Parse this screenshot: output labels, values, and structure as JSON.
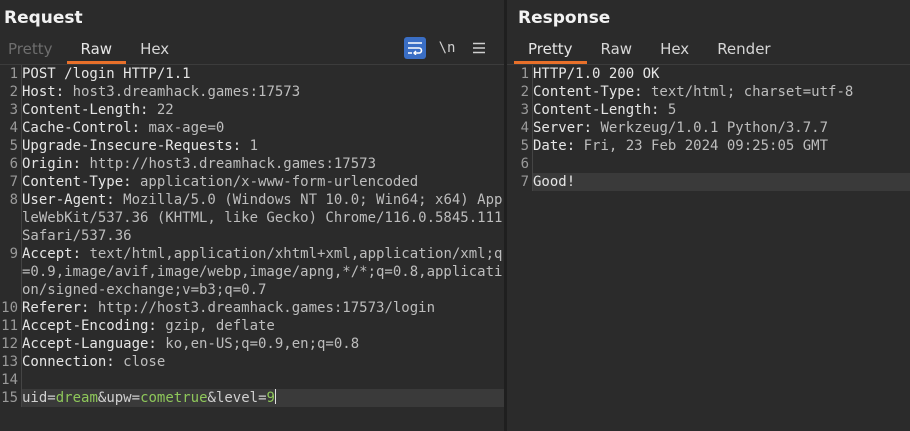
{
  "request": {
    "title": "Request",
    "tabs": [
      {
        "label": "Pretty",
        "state": "disabled"
      },
      {
        "label": "Raw",
        "state": "active"
      },
      {
        "label": "Hex",
        "state": "normal"
      }
    ],
    "toolbar": {
      "newline_label": "\\n"
    },
    "lines": [
      {
        "num": "1",
        "name": "POST /login HTTP/1.1",
        "value": ""
      },
      {
        "num": "2",
        "name": "Host:",
        "value": " host3.dreamhack.games:17573"
      },
      {
        "num": "3",
        "name": "Content-Length:",
        "value": " 22"
      },
      {
        "num": "4",
        "name": "Cache-Control:",
        "value": " max-age=0"
      },
      {
        "num": "5",
        "name": "Upgrade-Insecure-Requests:",
        "value": " 1"
      },
      {
        "num": "6",
        "name": "Origin:",
        "value": " http://host3.dreamhack.games:17573"
      },
      {
        "num": "7",
        "name": "Content-Type:",
        "value": " application/x-www-form-urlencoded"
      },
      {
        "num": "8",
        "name": "User-Agent:",
        "value": " Mozilla/5.0 (Windows NT 10.0; Win64; x64) AppleWebKit/537.36 (KHTML, like Gecko) Chrome/116.0.5845.111 Safari/537.36"
      },
      {
        "num": "9",
        "name": "Accept:",
        "value": " text/html,application/xhtml+xml,application/xml;q=0.9,image/avif,image/webp,image/apng,*/*;q=0.8,application/signed-exchange;v=b3;q=0.7"
      },
      {
        "num": "10",
        "name": "Referer:",
        "value": " http://host3.dreamhack.games:17573/login"
      },
      {
        "num": "11",
        "name": "Accept-Encoding:",
        "value": " gzip, deflate"
      },
      {
        "num": "12",
        "name": "Accept-Language:",
        "value": " ko,en-US;q=0.9,en;q=0.8"
      },
      {
        "num": "13",
        "name": "Connection:",
        "value": " close"
      },
      {
        "num": "14",
        "name": "",
        "value": ""
      }
    ],
    "body_line": {
      "num": "15",
      "params": [
        {
          "key": "uid",
          "eq": "=",
          "val": "dream",
          "amp": "&"
        },
        {
          "key": "upw",
          "eq": "=",
          "val": "cometrue",
          "amp": "&"
        },
        {
          "key": "level",
          "eq": "=",
          "val": "9",
          "amp": ""
        }
      ]
    }
  },
  "response": {
    "title": "Response",
    "tabs": [
      {
        "label": "Pretty",
        "state": "active"
      },
      {
        "label": "Raw",
        "state": "normal"
      },
      {
        "label": "Hex",
        "state": "normal"
      },
      {
        "label": "Render",
        "state": "normal"
      }
    ],
    "lines": [
      {
        "num": "1",
        "name": "HTTP/1.0 200 OK",
        "value": ""
      },
      {
        "num": "2",
        "name": "Content-Type:",
        "value": " text/html; charset=utf-8"
      },
      {
        "num": "3",
        "name": "Content-Length:",
        "value": " 5"
      },
      {
        "num": "4",
        "name": "Server:",
        "value": " Werkzeug/1.0.1 Python/3.7.7"
      },
      {
        "num": "5",
        "name": "Date:",
        "value": " Fri, 23 Feb 2024 09:25:05 GMT"
      },
      {
        "num": "6",
        "name": "",
        "value": ""
      },
      {
        "num": "7",
        "name": "Good!",
        "value": "",
        "highlight": true
      }
    ]
  }
}
